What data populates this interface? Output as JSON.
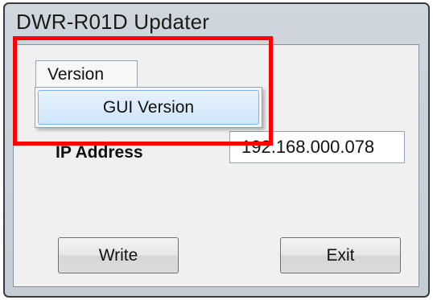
{
  "window": {
    "title": "DWR-R01D Updater"
  },
  "menubar": {
    "version_menu": {
      "label": "Version",
      "items": [
        {
          "label": "GUI Version"
        }
      ]
    }
  },
  "form": {
    "ip_address_label": "IP Address",
    "ip_address_value": "192.168.000.078"
  },
  "buttons": {
    "write_label": "Write",
    "exit_label": "Exit"
  },
  "annotation": {
    "highlight_color": "#ff0000"
  }
}
